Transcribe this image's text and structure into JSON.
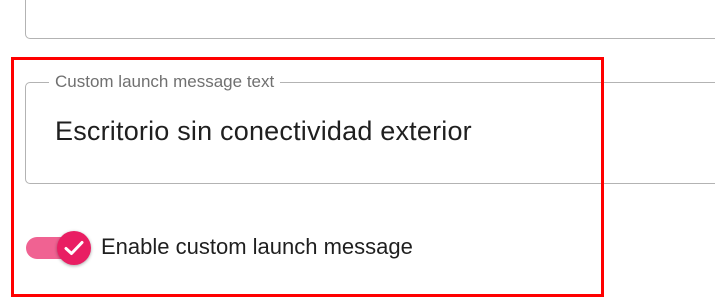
{
  "custom_launch_message": {
    "label": "Custom launch message text",
    "value": "Escritorio sin conectividad exterior"
  },
  "enable_toggle": {
    "label": "Enable custom launch message",
    "checked": true,
    "icon": "check-icon"
  },
  "colors": {
    "accent": "#e91e63",
    "track": "#f06292",
    "highlight": "#ff0000",
    "border": "#b3b3b3"
  }
}
